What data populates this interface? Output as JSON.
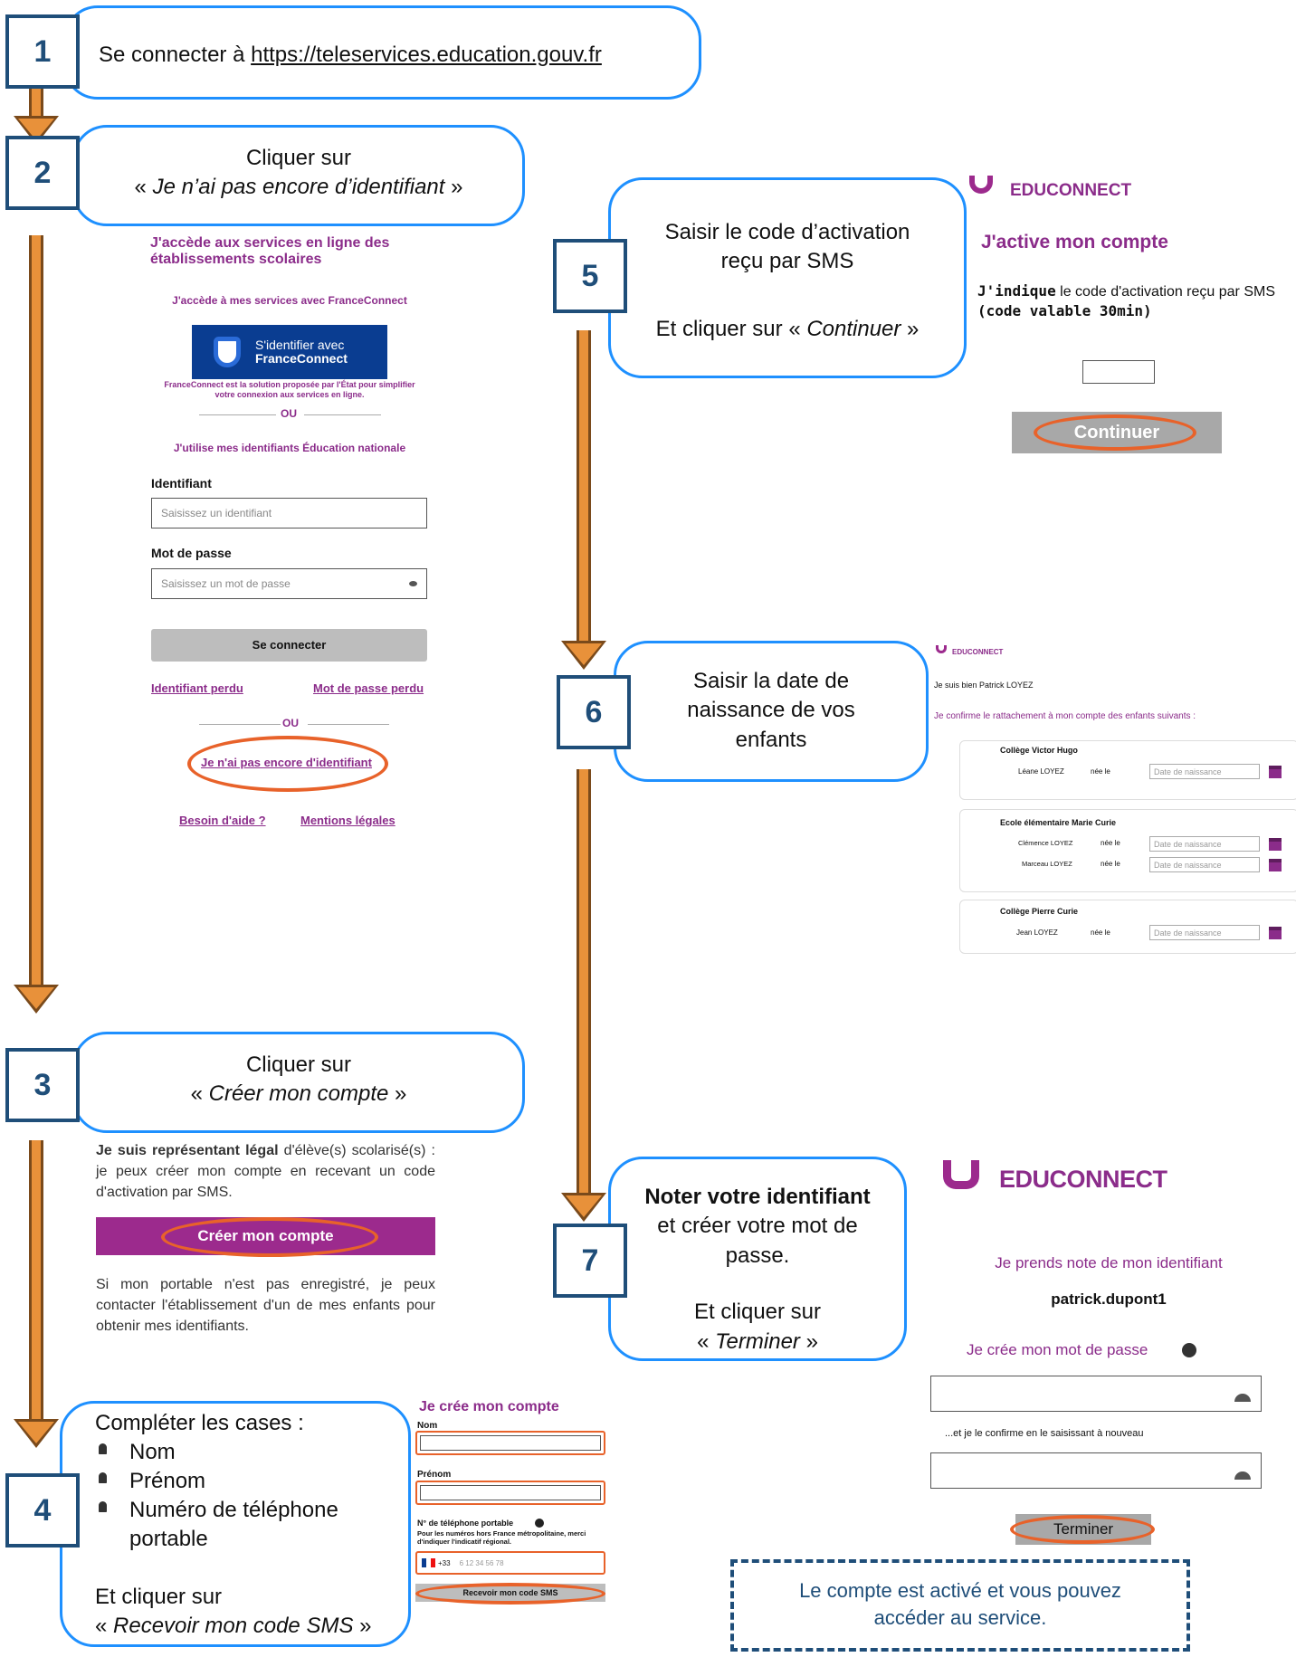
{
  "step1": {
    "number": "1",
    "text": "Se connecter à ",
    "link": "https://teleservices.education.gouv.fr"
  },
  "step2": {
    "number": "2",
    "line1": "Cliquer sur",
    "line2_open": "« ",
    "line2_em": "Je n’ai pas encore d’identifiant",
    "line2_close": " »"
  },
  "login_screen": {
    "title": "J'accède aux services en ligne des établissements scolaires",
    "fc_heading": "J'accède à mes services avec FranceConnect",
    "fc_button_line1": "S'identifier avec",
    "fc_button_line2": "FranceConnect",
    "fc_desc": "FranceConnect est la solution proposée par l'État pour simplifier votre connexion aux services en ligne.",
    "ou1": "OU",
    "en_heading": "J'utilise mes identifiants Éducation nationale",
    "id_label": "Identifiant",
    "id_placeholder": "Saisissez un identifiant",
    "pw_label": "Mot de passe",
    "pw_placeholder": "Saisissez un mot de passe",
    "connect_button": "Se connecter",
    "lost_id": "Identifiant perdu",
    "lost_pw": "Mot de passe perdu",
    "ou2": "OU",
    "no_id_link": "Je n'ai pas encore d'identifiant",
    "help_link": "Besoin d'aide ?",
    "legal_link": "Mentions légales"
  },
  "step3": {
    "number": "3",
    "line1": "Cliquer sur",
    "line2_open": "« ",
    "line2_em": "Créer mon compte",
    "line2_close": " »"
  },
  "create_screen": {
    "para1_bold": "Je suis représentant légal",
    "para1_rest": " d'élève(s) scolarisé(s) : je peux créer mon compte en recevant un code d'activation par SMS.",
    "button": "Créer mon compte",
    "para2": "Si mon portable n'est pas enregistré, je peux contacter l'établissement d'un de mes enfants pour obtenir mes identifiants."
  },
  "step4": {
    "number": "4",
    "intro": "Compléter les cases :",
    "items": [
      "Nom",
      "Prénom",
      "Numéro de téléphone portable"
    ],
    "outro1": "Et cliquer sur",
    "outro2_open": "« ",
    "outro2_em": "Recevoir mon code SMS",
    "outro2_close": " »"
  },
  "form_screen": {
    "title": "Je crée mon compte",
    "nom": "Nom",
    "prenom": "Prénom",
    "phone_label": "N° de téléphone portable",
    "phone_help": "Pour les numéros hors France métropolitaine, merci d'indiquer l'indicatif régional.",
    "prefix": "+33",
    "phone_placeholder": "6 12 34 56 78",
    "sms_button": "Recevoir mon code SMS"
  },
  "step5": {
    "number": "5",
    "line1": "Saisir le code d’activation",
    "line2": "reçu par SMS",
    "line3_open": "Et cliquer sur « ",
    "line3_em": "Continuer",
    "line3_close": " »"
  },
  "activate_screen": {
    "brand": "EDUCONNECT",
    "title": "J'active mon compte",
    "text_bold": "J'indique",
    "text_rest": " le code d'activation reçu par SMS ",
    "text_hint": "(code valable 30min)",
    "button": "Continuer"
  },
  "step6": {
    "number": "6",
    "line1": "Saisir la date de",
    "line2": "naissance de vos",
    "line3": "enfants"
  },
  "children_screen": {
    "brand": "EDUCONNECT",
    "intro": "Je suis bien Patrick LOYEZ",
    "confirm": "Je confirme le rattachement à mon compte des enfants suivants :",
    "schools": [
      {
        "name": "Collège Victor Hugo",
        "children": [
          {
            "name": "Léane LOYEZ",
            "born": "née le"
          }
        ]
      },
      {
        "name": "Ecole élémentaire Marie Curie",
        "children": [
          {
            "name": "Clémence LOYEZ",
            "born": "née le"
          },
          {
            "name": "Marceau LOYEZ",
            "born": "née le"
          }
        ]
      },
      {
        "name": "Collège Pierre Curie",
        "children": [
          {
            "name": "Jean LOYEZ",
            "born": "née le"
          }
        ]
      }
    ],
    "date_placeholder": "Date de naissance"
  },
  "step7": {
    "number": "7",
    "line1_bold": "Noter votre identifiant",
    "line2": "et créer votre mot de",
    "line3": "passe.",
    "line4": "Et cliquer sur",
    "line5_open": "« ",
    "line5_em": "Terminer",
    "line5_close": " »"
  },
  "finish_screen": {
    "brand": "EDUCONNECT",
    "note": "Je prends note de mon identifiant",
    "identifier": "patrick.dupont1",
    "create_pw": "Je crée mon mot de passe",
    "confirm_pw": "...et je le confirme en le saisissant à nouveau",
    "button": "Terminer"
  },
  "final_note": {
    "line1": "Le compte est activé et vous pouvez",
    "line2": "accéder au service."
  },
  "colors": {
    "bubble_border": "#1e90ff",
    "number_border": "#1f4e79",
    "arrow": "#e8913a",
    "purple": "#8b2c8a",
    "highlight": "#e8622a"
  }
}
